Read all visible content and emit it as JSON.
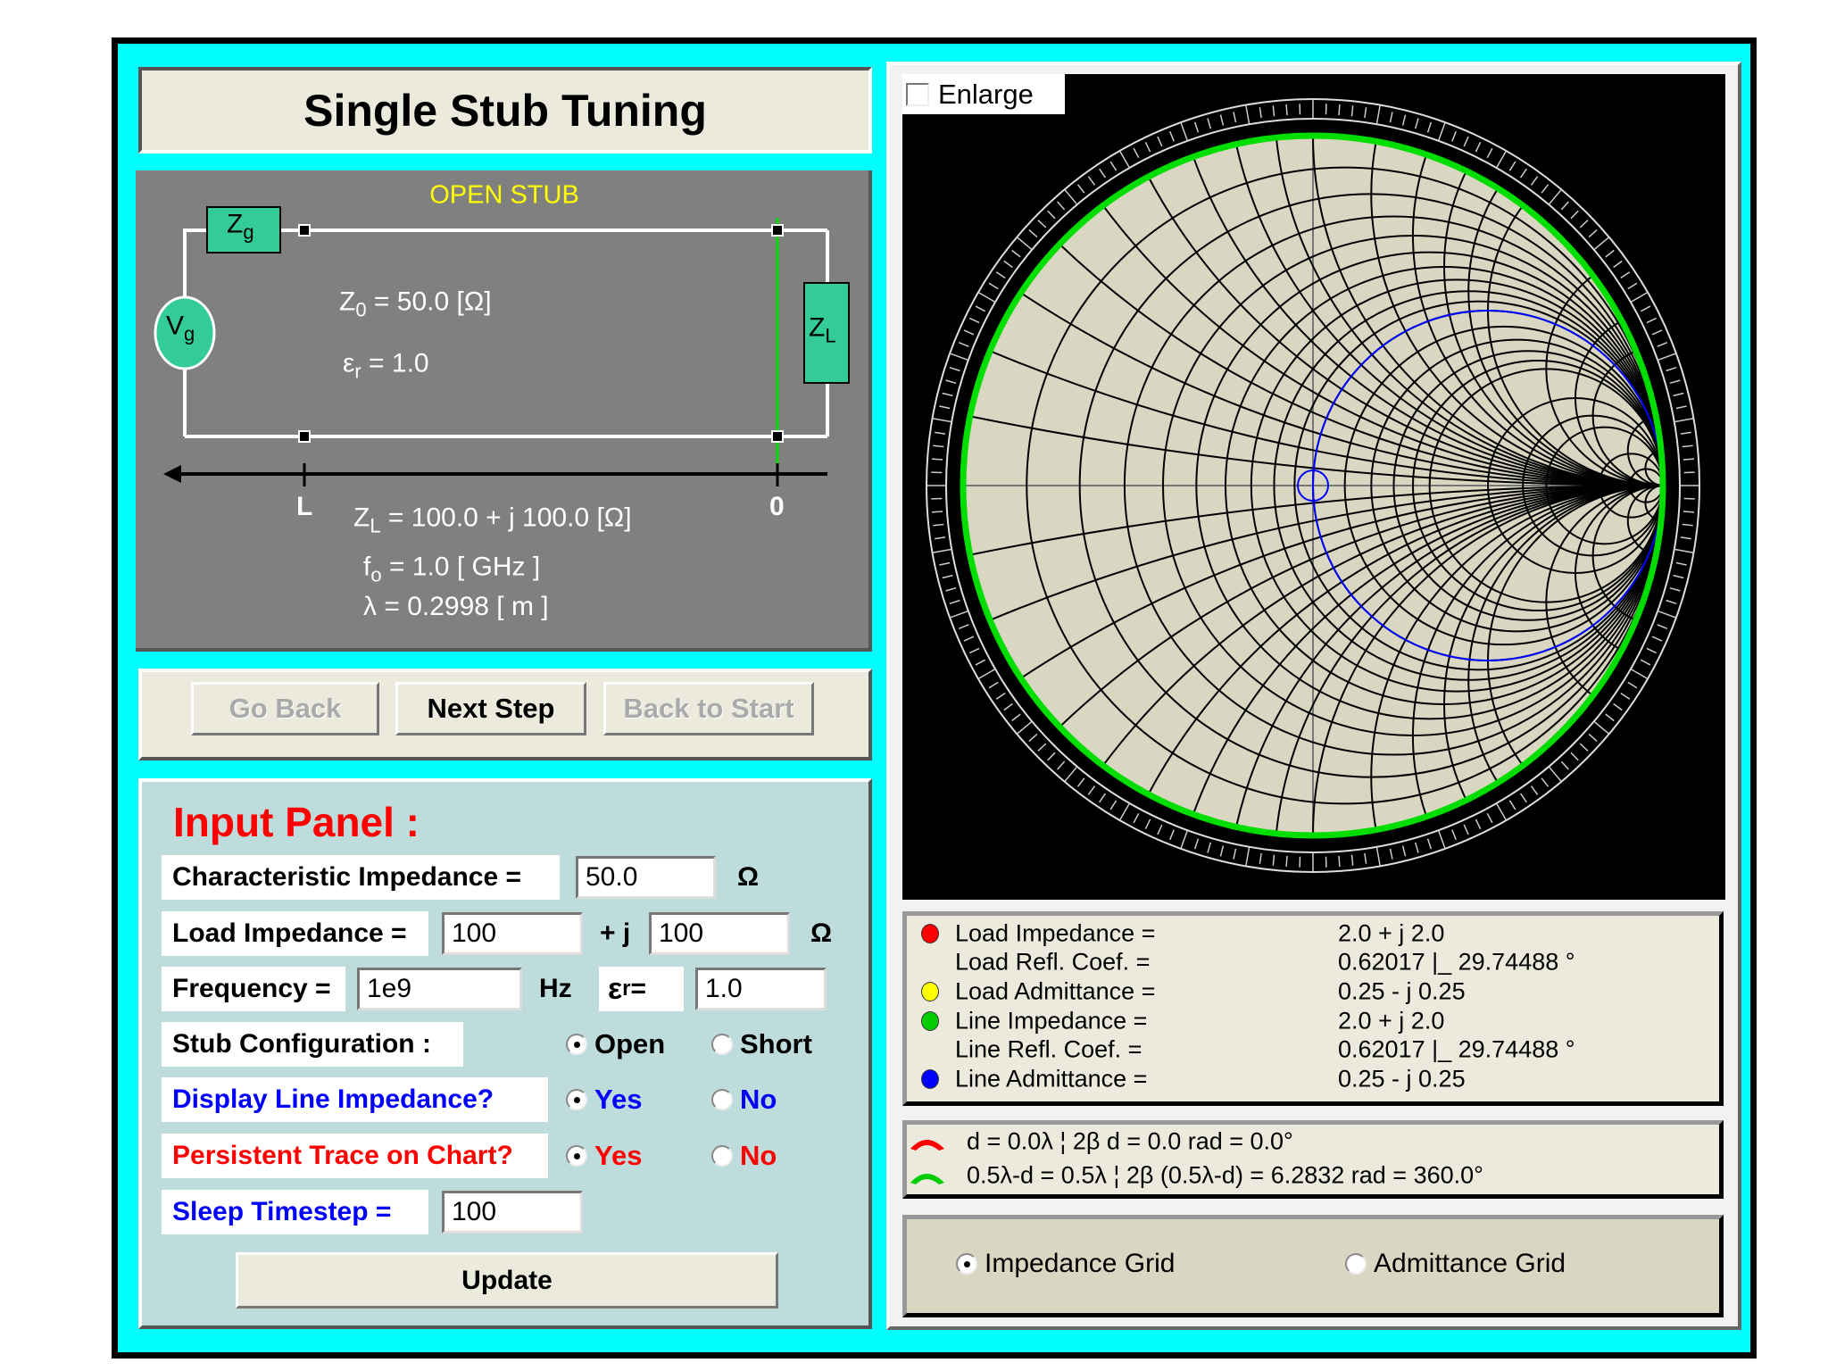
{
  "title": "Single Stub Tuning",
  "circuit": {
    "stub_type": "OPEN STUB",
    "zg_label": "Z",
    "zg_sub": "g",
    "vg_label": "V",
    "vg_sub": "g",
    "zl_label": "Z",
    "zl_sub": "L",
    "z0_name": "Z",
    "z0_sub": "0",
    "z0_value": "=  50.0 [Ω]",
    "er_name": "ε",
    "er_sub": "r",
    "er_value": "=  1.0",
    "axis_L": "L",
    "axis_0": "0",
    "zl_name": "Z",
    "zl_name_sub": "L",
    "zl_value": "=  100.0 + j 100.0 [Ω]",
    "f_name": "f",
    "f_sub": "o",
    "f_value": "=  1.0   [ GHz ]",
    "lambda_text": "λ  =  0.2998 [ m ]"
  },
  "buttons": {
    "go_back": "Go Back",
    "next_step": "Next Step",
    "back_to_start": "Back to Start"
  },
  "input_panel": {
    "title": "Input Panel :",
    "char_impedance_label": "Characteristic Impedance =",
    "char_impedance_value": "50.0",
    "ohm": "Ω",
    "load_impedance_label": "Load Impedance =",
    "load_real": "100",
    "plus_j": "+ j",
    "load_imag": "100",
    "frequency_label": "Frequency =",
    "frequency_value": "1e9",
    "hz": "Hz",
    "er_label": "ε",
    "er_sub": "r",
    "er_eq": " =",
    "er_value": "1.0",
    "stub_config_label": "Stub Configuration :",
    "open": "Open",
    "short": "Short",
    "display_line_label": "Display Line Impedance?",
    "persistent_label": "Persistent Trace on Chart?",
    "yes": "Yes",
    "no": "No",
    "sleep_label": "Sleep Timestep =",
    "sleep_value": "100",
    "update": "Update"
  },
  "chart": {
    "enlarge": "Enlarge",
    "resistance_circles": [
      0.1,
      0.2,
      0.3,
      0.4,
      0.5,
      0.6,
      0.7,
      0.8,
      0.9,
      1,
      1.2,
      1.4,
      1.6,
      1.8,
      2,
      3,
      4,
      5,
      10,
      20
    ],
    "reactance_arcs": [
      0.1,
      0.2,
      0.3,
      0.4,
      0.5,
      0.6,
      0.7,
      0.8,
      0.9,
      1,
      1.2,
      1.4,
      1.6,
      1.8,
      2,
      3,
      4,
      5,
      10,
      20
    ],
    "highlight_resistance": 1,
    "colors": {
      "grid_bg": "#d9d7c1",
      "rim": "#00dd00",
      "highlight": "#0000ff"
    }
  },
  "results": {
    "rows": [
      {
        "label": "Load Impedance =",
        "value": "2.0 + j 2.0",
        "dot": "#ff0000"
      },
      {
        "label": "Load Refl. Coef. =",
        "value": "0.62017   |_ 29.74488 °",
        "dot": ""
      },
      {
        "label": "Load Admittance =",
        "value": "0.25 - j 0.25",
        "dot": "#ffff00"
      },
      {
        "label": "Line Impedance =",
        "value": "2.0 + j 2.0",
        "dot": "#00cc00"
      },
      {
        "label": "Line Refl. Coef. =",
        "value": "0.62017   |_ 29.74488 °",
        "dot": ""
      },
      {
        "label": "Line Admittance =",
        "value": "0.25 - j 0.25",
        "dot": "#0000ff"
      }
    ],
    "distance1": "d = 0.0λ  ¦  2β d = 0.0 rad = 0.0°",
    "distance2": "0.5λ-d = 0.5λ  ¦  2β (0.5λ-d) = 6.2832 rad = 360.0°"
  },
  "grid_options": {
    "impedance": "Impedance Grid",
    "admittance": "Admittance Grid"
  }
}
